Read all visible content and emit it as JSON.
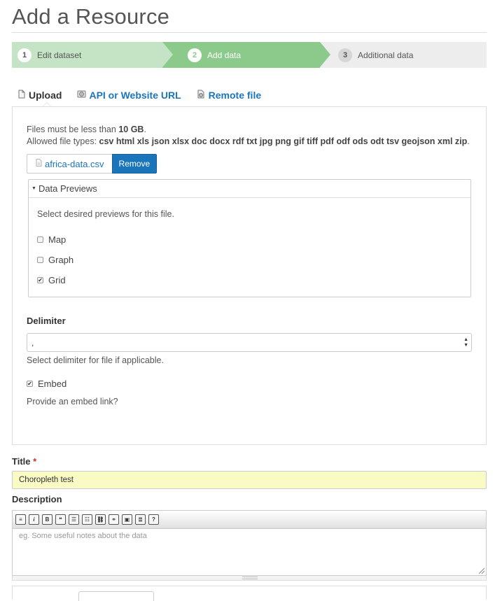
{
  "page": {
    "title": "Add a Resource"
  },
  "stages": [
    {
      "num": "1",
      "label": "Edit dataset"
    },
    {
      "num": "2",
      "label": "Add data"
    },
    {
      "num": "3",
      "label": "Additional data"
    }
  ],
  "upload_tabs": {
    "upload": "Upload",
    "url": "API or Website URL",
    "remote": "Remote file"
  },
  "upload": {
    "size_prefix": "Files must be less than ",
    "size_limit": "10 GB",
    "size_suffix": ".",
    "types_prefix": "Allowed file types: ",
    "types": "csv html xls json xlsx doc docx rdf txt jpg png gif tiff pdf odf ods odt tsv geojson xml zip",
    "types_suffix": ".",
    "file_name": "africa-data.csv",
    "remove_label": "Remove"
  },
  "previews": {
    "heading": "Data Previews",
    "lead": "Select desired previews for this file.",
    "options": [
      {
        "label": "Map",
        "checked": false
      },
      {
        "label": "Graph",
        "checked": false
      },
      {
        "label": "Grid",
        "checked": true
      }
    ]
  },
  "delimiter": {
    "label": "Delimiter",
    "value": ",",
    "help": "Select delimiter for file if applicable."
  },
  "embed": {
    "label": "Embed",
    "checked": true,
    "help": "Provide an embed link?"
  },
  "title_field": {
    "label": "Title",
    "required_mark": "*",
    "value": "Choropleth test"
  },
  "description": {
    "label": "Description",
    "placeholder": "eg. Some useful notes about the data"
  },
  "colors": {
    "link": "#1b75bb",
    "stage_done": "#c5e4c5",
    "stage_active": "#8cca8c",
    "stage_todo": "#ededed",
    "title_bg": "#fafac4"
  }
}
